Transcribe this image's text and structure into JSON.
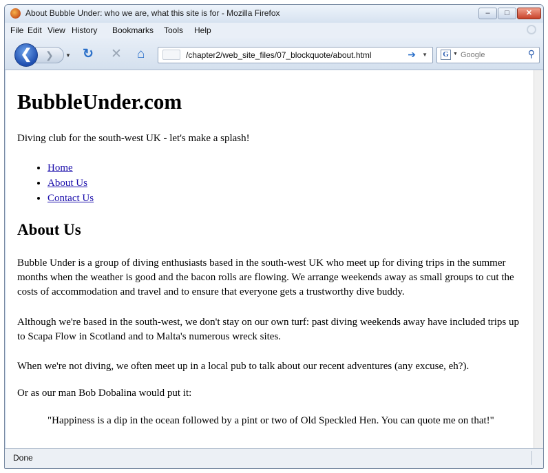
{
  "window": {
    "title": "About Bubble Under: who we are, what this site is for - Mozilla Firefox",
    "min_label": "–",
    "max_label": "□",
    "close_label": "✕"
  },
  "menu": [
    "File",
    "Edit",
    "View",
    "History",
    "Bookmarks",
    "Tools",
    "Help"
  ],
  "toolbar": {
    "back_glyph": "❮",
    "forward_glyph": "❯",
    "reload_glyph": "↻",
    "stop_glyph": "✕",
    "home_glyph": "⌂",
    "url": "/chapter2/web_site_files/07_blockquote/about.html",
    "go_glyph": "➔",
    "search_engine_glyph": "G",
    "search_placeholder": "Google",
    "search_glyph": "⚲"
  },
  "page": {
    "site_title": "BubbleUnder.com",
    "tagline": "Diving club for the south-west UK - let's make a splash!",
    "nav": [
      "Home",
      "About Us",
      "Contact Us"
    ],
    "heading": "About Us",
    "paragraphs": [
      "Bubble Under is a group of diving enthusiasts based in the south-west UK who meet up for diving trips in the summer months when the weather is good and the bacon rolls are flowing. We arrange weekends away as small groups to cut the costs of accommodation and travel and to ensure that everyone gets a trustworthy dive buddy.",
      "Although we're based in the south-west, we don't stay on our own turf: past diving weekends away have included trips up to Scapa Flow in Scotland and to Malta's numerous wreck sites.",
      "When we're not diving, we often meet up in a local pub to talk about our recent adventures (any excuse, eh?).",
      "Or as our man Bob Dobalina would put it:"
    ],
    "blockquote": "\"Happiness is a dip in the ocean followed by a pint or two of Old Speckled Hen. You can quote me on that!\""
  },
  "status": {
    "text": "Done"
  },
  "colors": {
    "link": "#1a0dab",
    "close_button": "#c8422a",
    "back_button": "#1f4fb0"
  }
}
